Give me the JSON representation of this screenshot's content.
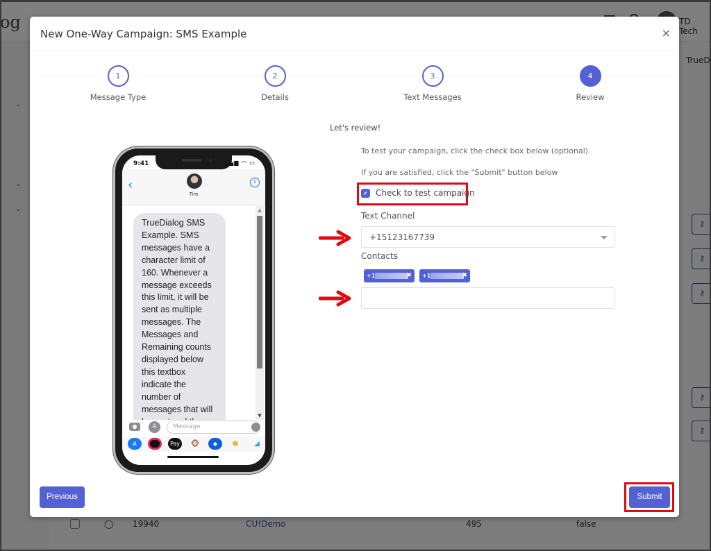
{
  "background_app": {
    "logo_fragment": "og",
    "user_name": "TD Tech",
    "column_header_fragment": "TrueD",
    "row": {
      "id": "19940",
      "name": "CU!Demo",
      "count": "495",
      "flag": "false"
    }
  },
  "modal": {
    "title": "New One-Way Campaign: SMS Example",
    "close_label": "×",
    "steps": [
      {
        "number": "1",
        "label": "Message Type",
        "state": "complete"
      },
      {
        "number": "2",
        "label": "Details",
        "state": "complete"
      },
      {
        "number": "3",
        "label": "Text Messages",
        "state": "complete"
      },
      {
        "number": "4",
        "label": "Review",
        "state": "active"
      }
    ],
    "phone_preview": {
      "status_time": "9:41",
      "status_icons": "▂▄▆ ◠ ▭",
      "contact_name": "Tim",
      "message": " TrueDialog SMS Example. SMS messages have a character limit of 160. Whenever a message exceeds this limit, it will be sent as multiple messages. The Messages and Remaining counts displayed below this textbox indicate the number of messages that will be sent and the characters left for...",
      "compose_placeholder": "Message",
      "app_strip": [
        "App Store",
        "Activity",
        "Apple Pay",
        "Animoji",
        "Dropbox",
        "Photos",
        "More"
      ]
    },
    "review": {
      "heading": "Let's review!",
      "instruction_test": "To test your campaign, click the check box below (optional)",
      "instruction_submit": "If you are satisfied, click the \"Submit\" button below",
      "test_checkbox": {
        "label": "Check to test campaign",
        "checked": true
      },
      "text_channel": {
        "label": "Text Channel",
        "value": "+15123167739"
      },
      "contacts": {
        "label": "Contacts",
        "tags": [
          {
            "prefix": "+1"
          },
          {
            "prefix": "+1"
          }
        ],
        "input_value": ""
      }
    },
    "buttons": {
      "previous": "Previous",
      "submit": "Submit"
    }
  },
  "colors": {
    "accent": "#5361d4",
    "annotation": "#e30613"
  }
}
